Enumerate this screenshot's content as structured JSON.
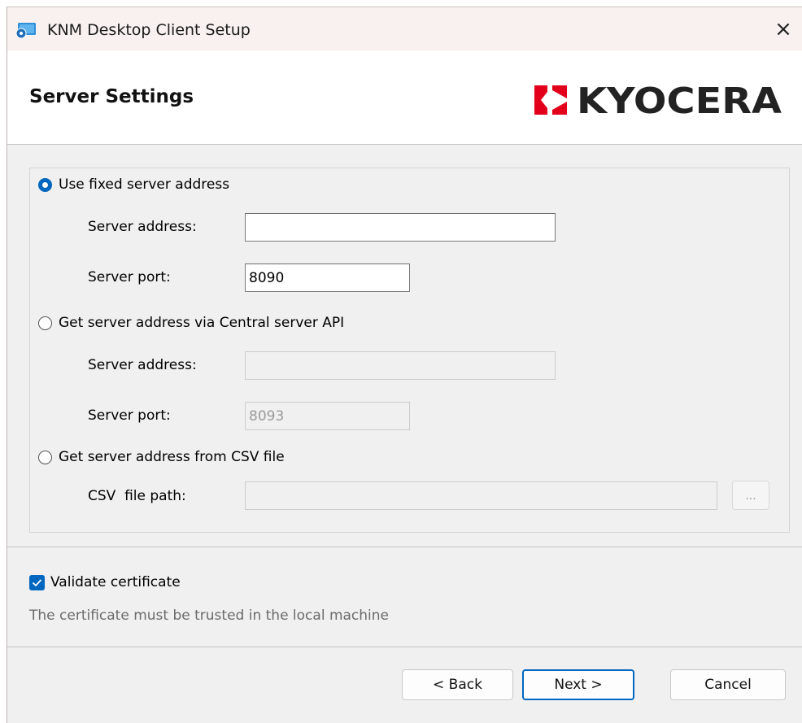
{
  "window": {
    "title": "KNM Desktop Client Setup",
    "close_symbol": "×",
    "icon": "installer-icon"
  },
  "banner": {
    "title": "Server Settings",
    "brand_logo": "KYOCERA",
    "logo_icon": "kyocera-logo-icon"
  },
  "options": {
    "fixed": {
      "label": "Use fixed server address",
      "selected": true,
      "address_label": "Server address:",
      "address_value": "",
      "port_label": "Server port:",
      "port_value": "8090"
    },
    "central_api": {
      "label": "Get server address via Central server API",
      "selected": false,
      "address_label": "Server address:",
      "address_value": "",
      "port_label": "Server port:",
      "port_value": "8093"
    },
    "csv": {
      "label": "Get server address from CSV file",
      "selected": false,
      "path_label": "CSV  file path:",
      "path_value": "",
      "browse_label": "..."
    }
  },
  "certificate": {
    "label": "Validate certificate",
    "checked": true,
    "hint": "The certificate must be trusted in the local machine"
  },
  "buttons": {
    "back": "< Back",
    "next": "Next >",
    "cancel": "Cancel"
  },
  "colors": {
    "accent": "#0067c0",
    "logo_red": "#e2001a",
    "title_bar": "#f9f1f0",
    "dialog_bg": "#f0f0f0"
  }
}
